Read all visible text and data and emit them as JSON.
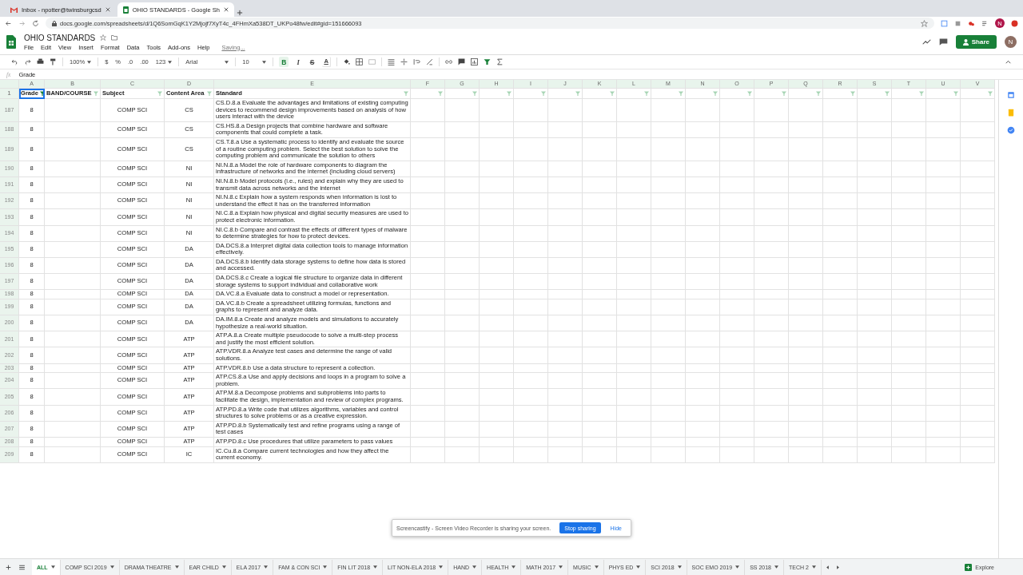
{
  "browser": {
    "tabs": [
      {
        "title": "Inbox - npotter@twinsburgcsd",
        "kind": "mail",
        "selected": false
      },
      {
        "title": "OHIO STANDARDS - Google Sh",
        "kind": "sheets",
        "selected": true
      }
    ],
    "url": "docs.google.com/spreadsheets/d/1Q6SomGqK1Y2Mjojf7XyT4c_4FHmXa538DT_UKPo48fw/edit#gid=151666093",
    "avatar": "N"
  },
  "doc": {
    "title": "OHIO STANDARDS",
    "menus": [
      "File",
      "Edit",
      "View",
      "Insert",
      "Format",
      "Data",
      "Tools",
      "Add-ons",
      "Help"
    ],
    "status": "Saving...",
    "share": "Share",
    "avatar": "N"
  },
  "toolbar": {
    "zoom": "100%",
    "currency": "$",
    "percent": "%",
    "decrease_decimals": ".0",
    "increase_decimals": ".00",
    "number_format": "123",
    "font": "Arial",
    "font_size": "10",
    "format_buttons": [
      {
        "label": "B",
        "kind": "bold",
        "active": true
      },
      {
        "label": "I",
        "kind": "italic",
        "active": false
      },
      {
        "label": "S",
        "kind": "strike",
        "active": false
      },
      {
        "label": "A",
        "kind": "color",
        "active": false
      }
    ],
    "filter_active": true
  },
  "formula_bar": {
    "label": "fx",
    "value": "Grade"
  },
  "columns": [
    "A",
    "B",
    "C",
    "D",
    "E",
    "F",
    "G",
    "H",
    "I",
    "J",
    "K",
    "L",
    "M",
    "N",
    "O",
    "P",
    "Q",
    "R",
    "S",
    "T",
    "U",
    "V"
  ],
  "header_row": {
    "row": "1",
    "cells": [
      {
        "text": "Grade",
        "filtered": true,
        "selected": true
      },
      {
        "text": "BAND/COURSE",
        "filtered": false,
        "selected": false
      },
      {
        "text": "Subject",
        "filtered": false,
        "selected": false
      },
      {
        "text": "Content Area",
        "filtered": false,
        "selected": false
      },
      {
        "text": "Standard",
        "filtered": false,
        "selected": false
      }
    ]
  },
  "rows": [
    {
      "row": "187",
      "grade": "8",
      "subject": "COMP SCI",
      "area": "CS",
      "standard": "CS.D.8.a Evaluate the advantages and limitations of existing computing devices to recommend design improvements based on analysis of how users interact with the device"
    },
    {
      "row": "188",
      "grade": "8",
      "subject": "COMP SCI",
      "area": "CS",
      "standard": "CS.HS.8.a Design projects that combine hardware and software components that could complete a task."
    },
    {
      "row": "189",
      "grade": "8",
      "subject": "COMP SCI",
      "area": "CS",
      "standard": "CS.T.8.a Use a systematic process to identify and evaluate the source of a routine computing problem. Select the best solution to solve the computing problem and communicate the solution to others"
    },
    {
      "row": "190",
      "grade": "8",
      "subject": "COMP SCI",
      "area": "NI",
      "standard": "NI.N.8.a Model the role of hardware components to diagram the infrastructure of networks and the internet (including cloud servers)"
    },
    {
      "row": "191",
      "grade": "8",
      "subject": "COMP SCI",
      "area": "NI",
      "standard": "NI.N.8.b Model protocols (i.e., rules) and explain why they are used to transmit data across networks and the internet"
    },
    {
      "row": "192",
      "grade": "8",
      "subject": "COMP SCI",
      "area": "NI",
      "standard": "NI.N.8.c Explain how a system responds when information is lost to understand the effect it has on the transferred information"
    },
    {
      "row": "193",
      "grade": "8",
      "subject": "COMP SCI",
      "area": "NI",
      "standard": "NI.C.8.a Explain how physical and digital security measures are used to protect electronic information."
    },
    {
      "row": "194",
      "grade": "8",
      "subject": "COMP SCI",
      "area": "NI",
      "standard": "NI.C.8.b Compare and contrast the effects of different types of malware to determine strategies for how to protect devices."
    },
    {
      "row": "195",
      "grade": "8",
      "subject": "COMP SCI",
      "area": "DA",
      "standard": "DA.DCS.8.a Interpret digital data collection tools to manage information effectively."
    },
    {
      "row": "196",
      "grade": "8",
      "subject": "COMP SCI",
      "area": "DA",
      "standard": "DA.DCS.8.b Identify data storage systems to define how data is stored and accessed."
    },
    {
      "row": "197",
      "grade": "8",
      "subject": "COMP SCI",
      "area": "DA",
      "standard": "DA.DCS.8.c Create a logical file structure to organize data in different storage systems to support individual and collaborative work"
    },
    {
      "row": "198",
      "grade": "8",
      "subject": "COMP SCI",
      "area": "DA",
      "standard": "DA.VC.8.a Evaluate data to construct a model or representation."
    },
    {
      "row": "199",
      "grade": "8",
      "subject": "COMP SCI",
      "area": "DA",
      "standard": "DA.VC.8.b Create a spreadsheet utilizing formulas, functions and graphs to represent and analyze data."
    },
    {
      "row": "200",
      "grade": "8",
      "subject": "COMP SCI",
      "area": "DA",
      "standard": "DA.IM.8.a Create and analyze models and simulations to accurately hypothesize a real-world situation."
    },
    {
      "row": "201",
      "grade": "8",
      "subject": "COMP SCI",
      "area": "ATP",
      "standard": "ATP.A.8.a Create multiple pseudocode to solve a multi-step process and justify the most efficient solution."
    },
    {
      "row": "202",
      "grade": "8",
      "subject": "COMP SCI",
      "area": "ATP",
      "standard": "ATP.VDR.8.a Analyze test cases and determine the range of valid solutions."
    },
    {
      "row": "203",
      "grade": "8",
      "subject": "COMP SCI",
      "area": "ATP",
      "standard": "ATP.VDR.8.b Use a data structure to represent a collection."
    },
    {
      "row": "204",
      "grade": "8",
      "subject": "COMP SCI",
      "area": "ATP",
      "standard": "ATP.CS.8.a Use and apply decisions and loops in a program to solve a problem."
    },
    {
      "row": "205",
      "grade": "8",
      "subject": "COMP SCI",
      "area": "ATP",
      "standard": "ATP.M.8.a Decompose problems and subproblems into parts to facilitate the design, implementation and review of complex programs."
    },
    {
      "row": "206",
      "grade": "8",
      "subject": "COMP SCI",
      "area": "ATP",
      "standard": "ATP.PD.8.a Write code that utilizes algorithms, variables and control structures to solve problems or as a creative expression."
    },
    {
      "row": "207",
      "grade": "8",
      "subject": "COMP SCI",
      "area": "ATP",
      "standard": "ATP.PD.8.b Systematically test and refine programs using a range of test cases"
    },
    {
      "row": "208",
      "grade": "8",
      "subject": "COMP SCI",
      "area": "ATP",
      "standard": "ATP.PD.8.c Use procedures that utilize parameters to pass values"
    },
    {
      "row": "209",
      "grade": "8",
      "subject": "COMP SCI",
      "area": "IC",
      "standard": "IC.Cu.8.a Compare current technologies and how they affect the current economy."
    }
  ],
  "sheet_tabs": [
    {
      "name": "ALL",
      "selected": true
    },
    {
      "name": "COMP SCI 2019",
      "selected": false
    },
    {
      "name": "DRAMA THEATRE",
      "selected": false
    },
    {
      "name": "EAR CHILD",
      "selected": false
    },
    {
      "name": "ELA 2017",
      "selected": false
    },
    {
      "name": "FAM & CON SCI",
      "selected": false
    },
    {
      "name": "FIN LIT 2018",
      "selected": false
    },
    {
      "name": "LIT NON-ELA 2018",
      "selected": false
    },
    {
      "name": "HAND",
      "selected": false
    },
    {
      "name": "HEALTH",
      "selected": false
    },
    {
      "name": "MATH 2017",
      "selected": false
    },
    {
      "name": "MUSIC",
      "selected": false
    },
    {
      "name": "PHYS ED",
      "selected": false
    },
    {
      "name": "SCI 2018",
      "selected": false
    },
    {
      "name": "SOC EMO 2019",
      "selected": false
    },
    {
      "name": "SS 2018",
      "selected": false
    },
    {
      "name": "TECH 2",
      "selected": false
    }
  ],
  "explore": "Explore",
  "share_notice": {
    "message": "Screencastify - Screen Video Recorder is sharing your screen.",
    "stop": "Stop sharing",
    "hide": "Hide"
  }
}
